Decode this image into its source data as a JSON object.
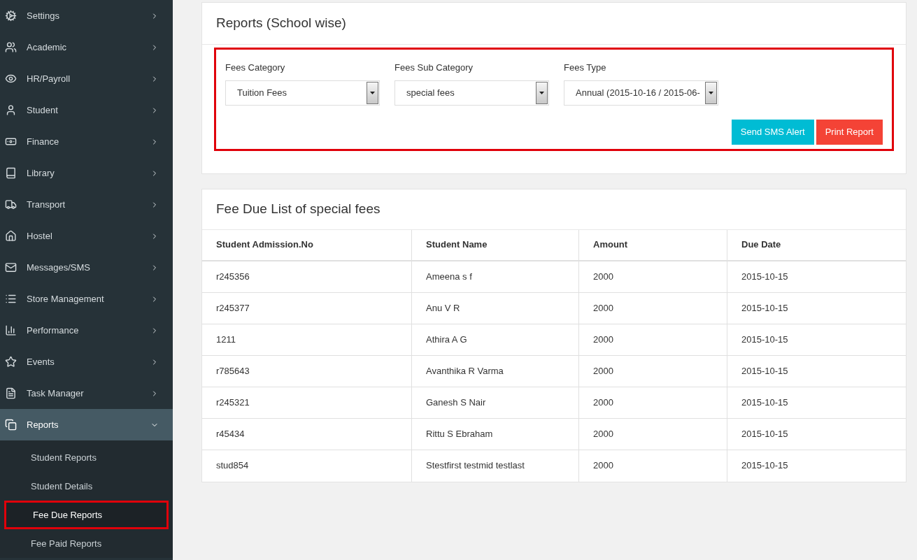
{
  "sidebar": {
    "items": [
      {
        "label": "Settings",
        "expanded": false
      },
      {
        "label": "Academic",
        "expanded": false
      },
      {
        "label": "HR/Payroll",
        "expanded": false
      },
      {
        "label": "Student",
        "expanded": false
      },
      {
        "label": "Finance",
        "expanded": false
      },
      {
        "label": "Library",
        "expanded": false
      },
      {
        "label": "Transport",
        "expanded": false
      },
      {
        "label": "Hostel",
        "expanded": false
      },
      {
        "label": "Messages/SMS",
        "expanded": false
      },
      {
        "label": "Store Management",
        "expanded": false
      },
      {
        "label": "Performance",
        "expanded": false
      },
      {
        "label": "Events",
        "expanded": false
      },
      {
        "label": "Task Manager",
        "expanded": false
      },
      {
        "label": "Reports",
        "expanded": true,
        "children": [
          {
            "label": "Student Reports",
            "selected": false,
            "highlighted": false
          },
          {
            "label": "Student Details",
            "selected": false,
            "highlighted": false
          },
          {
            "label": "Fee Due Reports",
            "selected": true,
            "highlighted": true
          },
          {
            "label": "Fee Paid Reports",
            "selected": false,
            "highlighted": false
          }
        ]
      }
    ]
  },
  "filters_card": {
    "title": "Reports (School wise)",
    "highlighted": true,
    "fields": [
      {
        "label": "Fees Category",
        "value": "Tuition Fees"
      },
      {
        "label": "Fees Sub Category",
        "value": "special fees"
      },
      {
        "label": "Fees Type",
        "value": "Annual (2015-10-16 / 2015-06-"
      }
    ],
    "buttons": [
      {
        "label": "Send SMS Alert",
        "kind": "info"
      },
      {
        "label": "Print Report",
        "kind": "danger"
      }
    ]
  },
  "table_card": {
    "title": "Fee Due List of special fees",
    "columns": [
      "Student Admission.No",
      "Student Name",
      "Amount",
      "Due Date"
    ],
    "rows": [
      [
        "r245356",
        "Ameena s f",
        "2000",
        "2015-10-15"
      ],
      [
        "r245377",
        "Anu V R",
        "2000",
        "2015-10-15"
      ],
      [
        "1211",
        "Athira A G",
        "2000",
        "2015-10-15"
      ],
      [
        "r785643",
        "Avanthika R Varma",
        "2000",
        "2015-10-15"
      ],
      [
        "r245321",
        "Ganesh S Nair",
        "2000",
        "2015-10-15"
      ],
      [
        "r45434",
        "Rittu S Ebraham",
        "2000",
        "2015-10-15"
      ],
      [
        "stud854",
        "Stestfirst testmid testlast",
        "2000",
        "2015-10-15"
      ]
    ]
  }
}
